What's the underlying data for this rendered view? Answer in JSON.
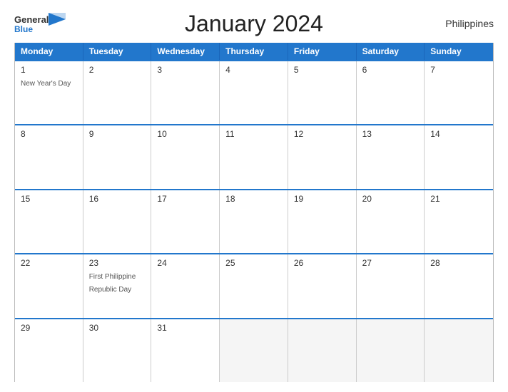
{
  "header": {
    "title": "January 2024",
    "country": "Philippines",
    "logo_general": "General",
    "logo_blue": "Blue"
  },
  "days_of_week": [
    "Monday",
    "Tuesday",
    "Wednesday",
    "Thursday",
    "Friday",
    "Saturday",
    "Sunday"
  ],
  "weeks": [
    [
      {
        "date": "1",
        "event": "New Year's Day",
        "empty": false
      },
      {
        "date": "2",
        "event": "",
        "empty": false
      },
      {
        "date": "3",
        "event": "",
        "empty": false
      },
      {
        "date": "4",
        "event": "",
        "empty": false
      },
      {
        "date": "5",
        "event": "",
        "empty": false
      },
      {
        "date": "6",
        "event": "",
        "empty": false
      },
      {
        "date": "7",
        "event": "",
        "empty": false
      }
    ],
    [
      {
        "date": "8",
        "event": "",
        "empty": false
      },
      {
        "date": "9",
        "event": "",
        "empty": false
      },
      {
        "date": "10",
        "event": "",
        "empty": false
      },
      {
        "date": "11",
        "event": "",
        "empty": false
      },
      {
        "date": "12",
        "event": "",
        "empty": false
      },
      {
        "date": "13",
        "event": "",
        "empty": false
      },
      {
        "date": "14",
        "event": "",
        "empty": false
      }
    ],
    [
      {
        "date": "15",
        "event": "",
        "empty": false
      },
      {
        "date": "16",
        "event": "",
        "empty": false
      },
      {
        "date": "17",
        "event": "",
        "empty": false
      },
      {
        "date": "18",
        "event": "",
        "empty": false
      },
      {
        "date": "19",
        "event": "",
        "empty": false
      },
      {
        "date": "20",
        "event": "",
        "empty": false
      },
      {
        "date": "21",
        "event": "",
        "empty": false
      }
    ],
    [
      {
        "date": "22",
        "event": "",
        "empty": false
      },
      {
        "date": "23",
        "event": "First Philippine Republic Day",
        "empty": false
      },
      {
        "date": "24",
        "event": "",
        "empty": false
      },
      {
        "date": "25",
        "event": "",
        "empty": false
      },
      {
        "date": "26",
        "event": "",
        "empty": false
      },
      {
        "date": "27",
        "event": "",
        "empty": false
      },
      {
        "date": "28",
        "event": "",
        "empty": false
      }
    ],
    [
      {
        "date": "29",
        "event": "",
        "empty": false
      },
      {
        "date": "30",
        "event": "",
        "empty": false
      },
      {
        "date": "31",
        "event": "",
        "empty": false
      },
      {
        "date": "",
        "event": "",
        "empty": true
      },
      {
        "date": "",
        "event": "",
        "empty": true
      },
      {
        "date": "",
        "event": "",
        "empty": true
      },
      {
        "date": "",
        "event": "",
        "empty": true
      }
    ]
  ]
}
